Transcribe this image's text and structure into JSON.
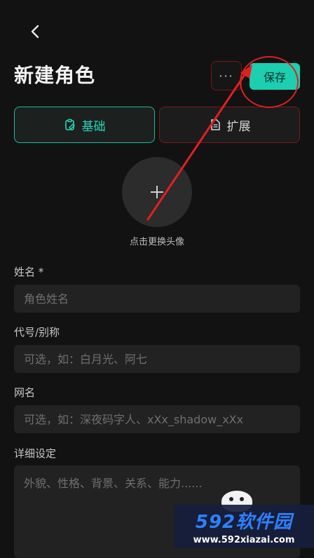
{
  "header": {
    "title": "新建角色",
    "more_label": "···",
    "save_label": "保存"
  },
  "tabs": [
    {
      "label": "基础",
      "icon": "clipboard-edit-icon",
      "active": true
    },
    {
      "label": "扩展",
      "icon": "document-icon",
      "active": false
    }
  ],
  "avatar": {
    "caption": "点击更换头像"
  },
  "fields": {
    "name": {
      "label": "姓名 *",
      "placeholder": "角色姓名",
      "value": ""
    },
    "alias": {
      "label": "代号/别称",
      "placeholder": "可选，如：白月光、阿七",
      "value": ""
    },
    "netname": {
      "label": "网名",
      "placeholder": "可选，如：深夜码字人、xXx_shadow_xXx",
      "value": ""
    },
    "details": {
      "label": "详细设定",
      "placeholder": "外貌、性格、背景、关系、能力......",
      "value": ""
    }
  },
  "watermark": {
    "brand": "592软件园",
    "url": "www.592xiazai.com"
  },
  "colors": {
    "accent": "#1ccfb0",
    "annotation": "#e02020",
    "background": "#121212"
  }
}
